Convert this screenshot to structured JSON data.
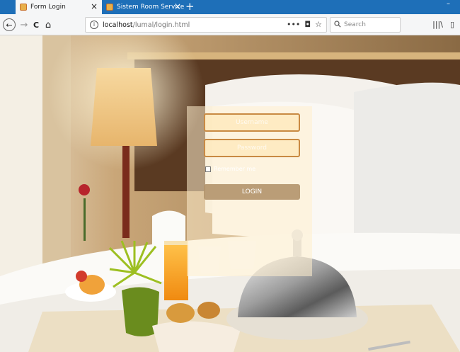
{
  "browser": {
    "tabs": [
      {
        "title": "Form Login",
        "active": true
      },
      {
        "title": "Sistem Room Service",
        "active": false
      }
    ],
    "tab_close_glyph": "×",
    "new_tab_glyph": "+",
    "window_controls": "–",
    "nav": {
      "back_glyph": "←",
      "forward_glyph": "→",
      "reload_glyph": "C",
      "home_glyph": "⌂"
    },
    "url": {
      "info_glyph": "i",
      "host": "localhost",
      "path": "/lumal/login.html",
      "more_glyph": "•••",
      "pocket_glyph": "◘",
      "star_glyph": "☆"
    },
    "search": {
      "placeholder": "Search",
      "icon": "search-icon"
    },
    "right_buttons": {
      "library_glyph": "|||\\",
      "sidebar_glyph": "▯"
    }
  },
  "login": {
    "username_placeholder": "Username",
    "password_placeholder": "Password",
    "remember_label": "Remember me",
    "login_label": "LOGIN"
  },
  "colors": {
    "tabstrip": "#1e6fb8",
    "field_border": "#c98a43",
    "button_bg": "#b2946c"
  }
}
